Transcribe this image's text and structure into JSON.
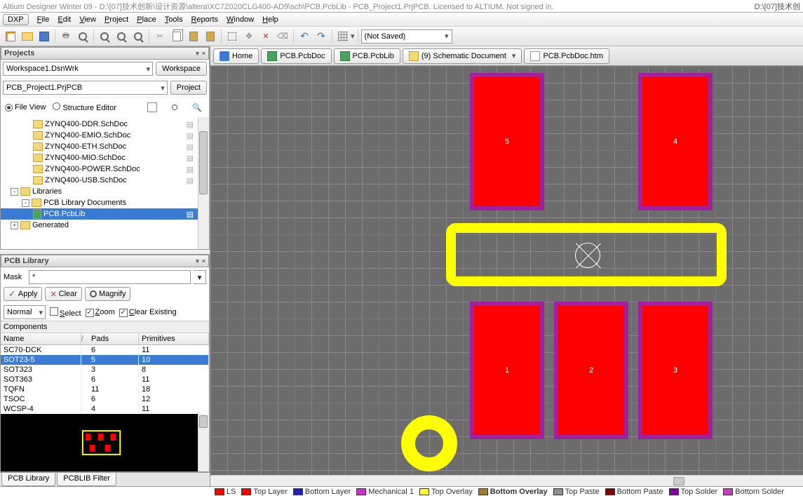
{
  "title_left": "Altium Designer Winter 09 - D:\\[07]技术创新\\设计资源\\altera\\XC7Z020CLG400-AD9\\sch\\PCB.PcbLib - PCB_Project1.PrjPCB. Licensed to ALTIUM. Not signed in.",
  "title_right": "D:\\[07]技术创",
  "menubar": {
    "dxp": "DXP",
    "items": [
      "File",
      "Edit",
      "View",
      "Project",
      "Place",
      "Tools",
      "Reports",
      "Window",
      "Help"
    ]
  },
  "toolbar": {
    "notsaved": "(Not Saved)"
  },
  "projects": {
    "title": "Projects",
    "workspace_combo": "Workspace1.DsnWrk",
    "workspace_btn": "Workspace",
    "project_text": "PCB_Project1.PrjPCB",
    "project_btn": "Project",
    "fileview": "File View",
    "structeditor": "Structure Editor",
    "tree": [
      {
        "indent": 2,
        "icon": "doc",
        "label": "ZYNQ400-DDR.SchDoc"
      },
      {
        "indent": 2,
        "icon": "doc",
        "label": "ZYNQ400-EMIO.SchDoc"
      },
      {
        "indent": 2,
        "icon": "doc",
        "label": "ZYNQ400-ETH.SchDoc"
      },
      {
        "indent": 2,
        "icon": "doc",
        "label": "ZYNQ400-MIO.SchDoc"
      },
      {
        "indent": 2,
        "icon": "doc",
        "label": "ZYNQ400-POWER.SchDoc"
      },
      {
        "indent": 2,
        "icon": "doc",
        "label": "ZYNQ400-USB.SchDoc"
      },
      {
        "indent": 0,
        "exp": "-",
        "icon": "folder",
        "label": "Libraries"
      },
      {
        "indent": 1,
        "exp": "-",
        "icon": "folder",
        "label": "PCB Library Documents"
      },
      {
        "indent": 2,
        "icon": "pcb",
        "label": "PCB.PcbLib",
        "sel": true
      },
      {
        "indent": 0,
        "exp": "+",
        "icon": "folder",
        "label": "Generated"
      }
    ]
  },
  "pcblib": {
    "title": "PCB Library",
    "mask_label": "Mask",
    "mask_value": "*",
    "apply": "Apply",
    "clear": "Clear",
    "magnify": "Magnify",
    "normal": "Normal",
    "select": "Select",
    "zoom": "Zoom",
    "clear_existing": "Clear Existing",
    "components": "Components",
    "columns": [
      "Name",
      "Pads",
      "Primitives"
    ],
    "rows": [
      {
        "name": "SC70-DCK",
        "pads": "6",
        "prim": "11"
      },
      {
        "name": "SOT23-5",
        "pads": "5",
        "prim": "10",
        "sel": true
      },
      {
        "name": "SOT323",
        "pads": "3",
        "prim": "8"
      },
      {
        "name": "SOT363",
        "pads": "6",
        "prim": "11"
      },
      {
        "name": "TQFN",
        "pads": "11",
        "prim": "18"
      },
      {
        "name": "TSOC",
        "pads": "6",
        "prim": "12"
      },
      {
        "name": "WCSP-4",
        "pads": "4",
        "prim": "11"
      }
    ]
  },
  "left_tabs": [
    "PCB Library",
    "PCBLIB Filter"
  ],
  "doc_tabs": [
    {
      "icon": "home",
      "label": "Home"
    },
    {
      "icon": "pcb",
      "label": "PCB.PcbDoc"
    },
    {
      "icon": "pcb",
      "label": "PCB.PcbLib"
    },
    {
      "icon": "sch",
      "label": "(9) Schematic Document",
      "dd": true
    },
    {
      "icon": "htm",
      "label": "PCB.PcbDoc.htm"
    }
  ],
  "pads": {
    "p1": "1",
    "p2": "2",
    "p3": "3",
    "p4": "4",
    "p5": "5"
  },
  "layers": [
    {
      "color": "#f00",
      "name": "LS"
    },
    {
      "color": "#f00",
      "name": "Top Layer"
    },
    {
      "color": "#2020c0",
      "name": "Bottom Layer"
    },
    {
      "color": "#d030d0",
      "name": "Mechanical 1"
    },
    {
      "color": "#ffff30",
      "name": "Top Overlay"
    },
    {
      "color": "#a08030",
      "name": "Bottom Overlay",
      "bold": true
    },
    {
      "color": "#909090",
      "name": "Top Paste"
    },
    {
      "color": "#800000",
      "name": "Bottom Paste"
    },
    {
      "color": "#8000a0",
      "name": "Top Solder"
    },
    {
      "color": "#c040c0",
      "name": "Bottom Solder"
    }
  ]
}
